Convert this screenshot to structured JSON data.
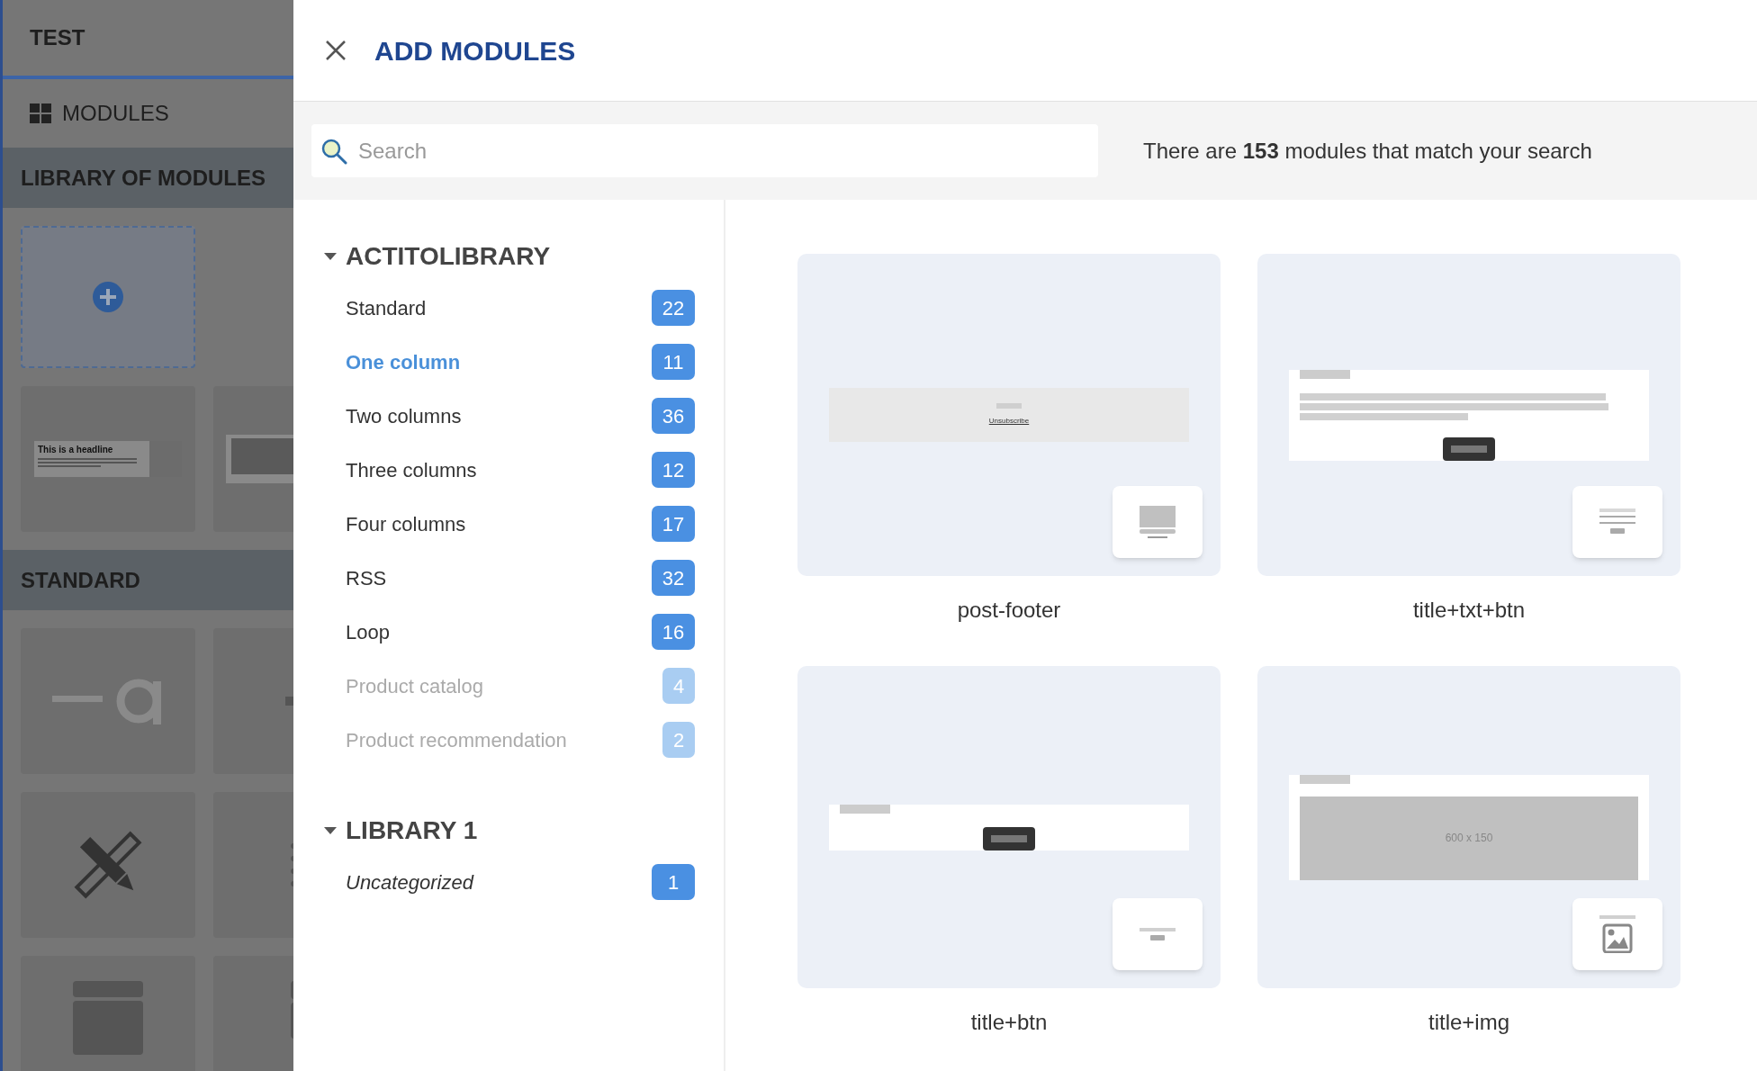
{
  "sidebar": {
    "title": "TEST",
    "nav_item": "MODULES",
    "sections": [
      {
        "title": "LIBRARY OF MODULES",
        "preview_headline": "This is a headline"
      },
      {
        "title": "STANDARD"
      }
    ]
  },
  "dialog": {
    "title": "ADD MODULES",
    "search": {
      "placeholder": "Search"
    },
    "result_text": "There are **153** modules that match your search",
    "libraries": [
      {
        "name": "ACTITOLIBRARY",
        "expanded": true,
        "categories": [
          {
            "label": "Standard",
            "count": "22",
            "selected": false,
            "disabled": false,
            "kind": "category"
          },
          {
            "label": "One column",
            "count": "11",
            "selected": true,
            "disabled": false,
            "kind": "category"
          },
          {
            "label": "Two columns",
            "count": "36",
            "selected": false,
            "disabled": false,
            "kind": "category"
          },
          {
            "label": "Three columns",
            "count": "12",
            "selected": false,
            "disabled": false,
            "kind": "category"
          },
          {
            "label": "Four columns",
            "count": "17",
            "selected": false,
            "disabled": false,
            "kind": "category"
          },
          {
            "label": "RSS",
            "count": "32",
            "selected": false,
            "disabled": false,
            "kind": "category"
          },
          {
            "label": "Loop",
            "count": "16",
            "selected": false,
            "disabled": false,
            "kind": "category"
          },
          {
            "label": "Product catalog",
            "count": "4",
            "selected": false,
            "disabled": true,
            "kind": "category"
          },
          {
            "label": "Product recommendation",
            "count": "2",
            "selected": false,
            "disabled": true,
            "kind": "category"
          }
        ]
      },
      {
        "name": "LIBRARY 1",
        "expanded": true,
        "categories": [
          {
            "label": "Uncategorized",
            "count": "1",
            "selected": false,
            "disabled": false,
            "kind": "uncategorized"
          }
        ]
      }
    ],
    "modules": [
      {
        "name": "post-footer",
        "kind": "footer",
        "preview_text": "Unsubscribe"
      },
      {
        "name": "title+txt+btn",
        "kind": "text"
      },
      {
        "name": "title+btn",
        "kind": "button"
      },
      {
        "name": "title+img",
        "kind": "image",
        "preview_text": "600 x 150"
      }
    ]
  }
}
